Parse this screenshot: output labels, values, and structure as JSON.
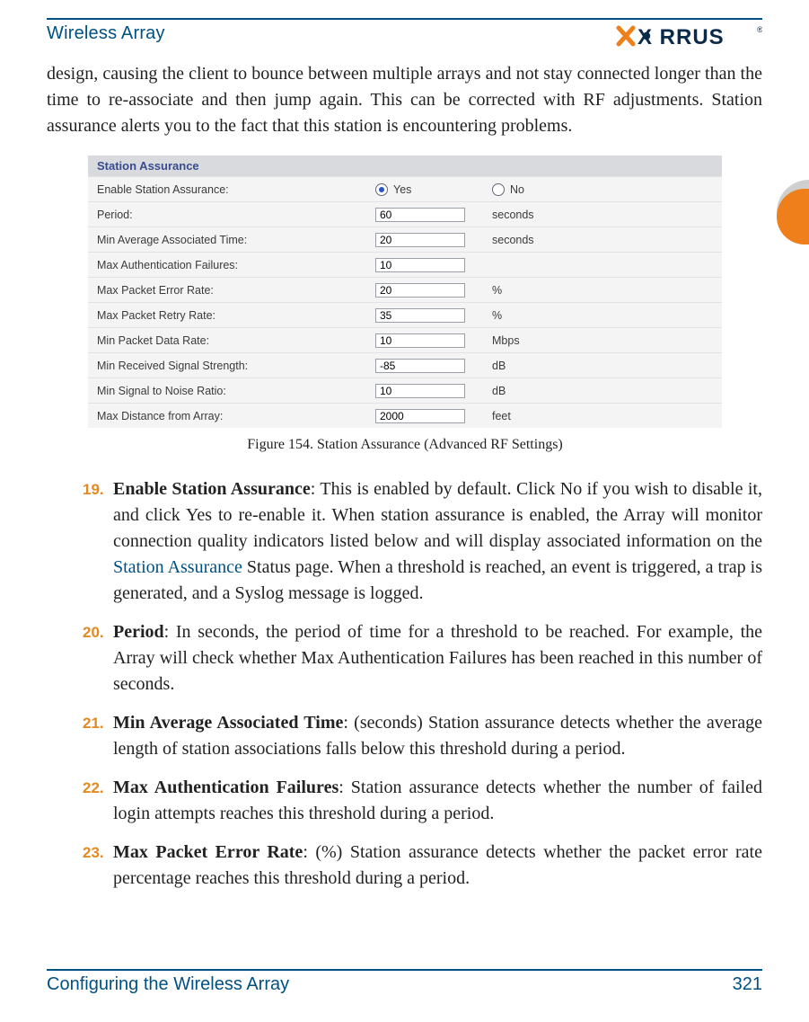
{
  "header": {
    "title": "Wireless Array"
  },
  "intro_paragraph": "design, causing the client to bounce between multiple arrays and not stay connected longer than the time to re-associate and then jump again. This can be corrected with RF adjustments. Station assurance alerts you to the fact that this station is encountering problems.",
  "figure": {
    "title": "Station Assurance",
    "caption": "Figure 154. Station Assurance (Advanced RF Settings)",
    "enable_row": {
      "label": "Enable Station Assurance:",
      "yes": "Yes",
      "no": "No"
    },
    "rows": [
      {
        "label": "Period:",
        "value": "60",
        "unit": "seconds"
      },
      {
        "label": "Min Average Associated Time:",
        "value": "20",
        "unit": "seconds"
      },
      {
        "label": "Max Authentication Failures:",
        "value": "10",
        "unit": ""
      },
      {
        "label": "Max Packet Error Rate:",
        "value": "20",
        "unit": "%"
      },
      {
        "label": "Max Packet Retry Rate:",
        "value": "35",
        "unit": "%"
      },
      {
        "label": "Min Packet Data Rate:",
        "value": "10",
        "unit": "Mbps"
      },
      {
        "label": "Min Received Signal Strength:",
        "value": "-85",
        "unit": "dB"
      },
      {
        "label": "Min Signal to Noise Ratio:",
        "value": "10",
        "unit": "dB"
      },
      {
        "label": "Max Distance from Array:",
        "value": "2000",
        "unit": "feet"
      }
    ]
  },
  "items": [
    {
      "num": "19.",
      "title": "Enable Station Assurance",
      "body": ": This is enabled by default. Click No if you wish to disable it, and click Yes to re-enable it. When station assurance is enabled, the Array will monitor connection quality indicators listed below and will display associated information on the ",
      "link": "Station Assurance",
      "tail": " Status page. When a threshold is reached, an event is triggered, a trap is generated, and a Syslog message is logged."
    },
    {
      "num": "20.",
      "title": "Period",
      "body": ": In seconds, the period of time for a threshold to be reached. For example, the Array will check whether Max Authentication Failures has been reached in this number of seconds."
    },
    {
      "num": "21.",
      "title": "Min Average Associated Time",
      "body": ": (seconds) Station assurance detects whether the average length of station associations falls below this threshold during a period."
    },
    {
      "num": "22.",
      "title": "Max Authentication Failures",
      "body": ": Station assurance detects whether the number of failed login attempts reaches this threshold during a period."
    },
    {
      "num": "23.",
      "title": "Max Packet Error Rate",
      "body": ": (%) Station assurance detects whether the packet error rate percentage reaches this threshold during a period."
    }
  ],
  "footer": {
    "section": "Configuring the Wireless Array",
    "page": "321"
  }
}
